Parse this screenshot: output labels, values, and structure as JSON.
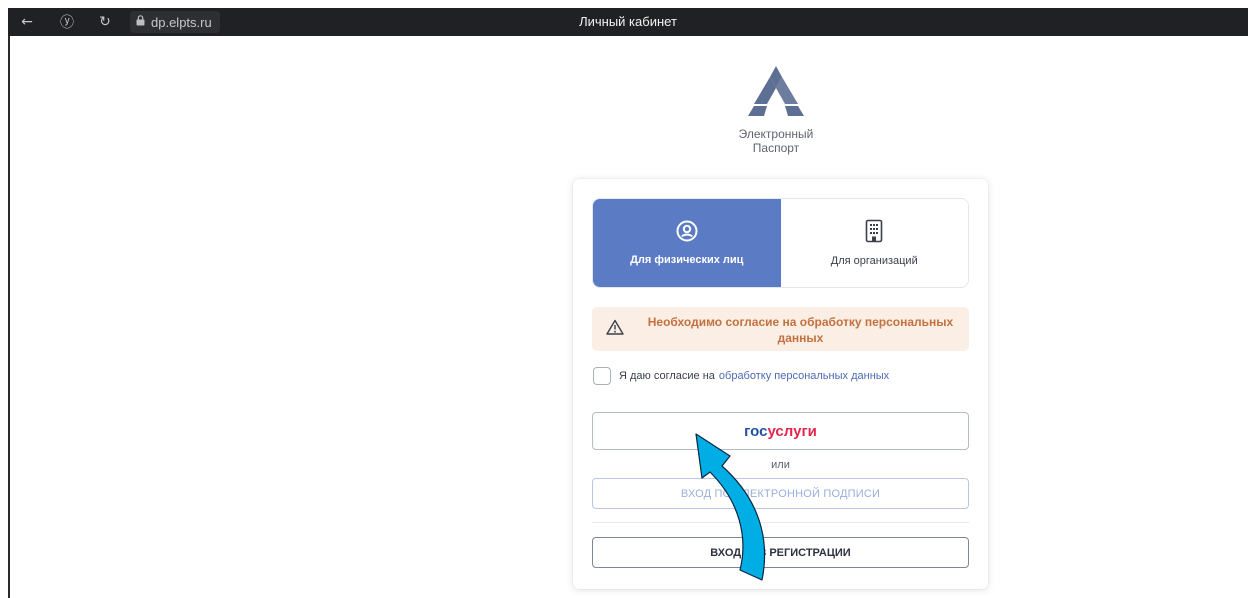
{
  "browser": {
    "back_icon": "←",
    "yandex_icon": "ⓨ",
    "reload_icon": "↻",
    "lock_icon": "lock",
    "url": "dp.elpts.ru",
    "title": "Личный кабинет"
  },
  "logo": {
    "line1": "Электронный",
    "line2": "Паспорт"
  },
  "tabs": [
    {
      "label": "Для физических лиц",
      "icon": "person-icon",
      "active": true
    },
    {
      "label": "Для организаций",
      "icon": "building-icon",
      "active": false
    }
  ],
  "warning": {
    "text": "Необходимо согласие на обработку персональных данных",
    "color": "#c2713f",
    "background": "#fbeee4"
  },
  "consent": {
    "text": "Я даю согласие на",
    "link": "обработку персональных данных",
    "checked": false
  },
  "gosuslugi": {
    "part1": "гос",
    "part2": "услуги"
  },
  "or_text": "или",
  "sign_button": "ВХОД ПО ЭЛЕКТРОННОЙ ПОДПИСИ",
  "noreg_button": "ВХОД БЕЗ РЕГИСТРАЦИИ",
  "colors": {
    "accent": "#5b7bc5",
    "arrow": "#00aee6",
    "gos_blue": "#1f50a3",
    "gos_red": "#e4264a"
  }
}
